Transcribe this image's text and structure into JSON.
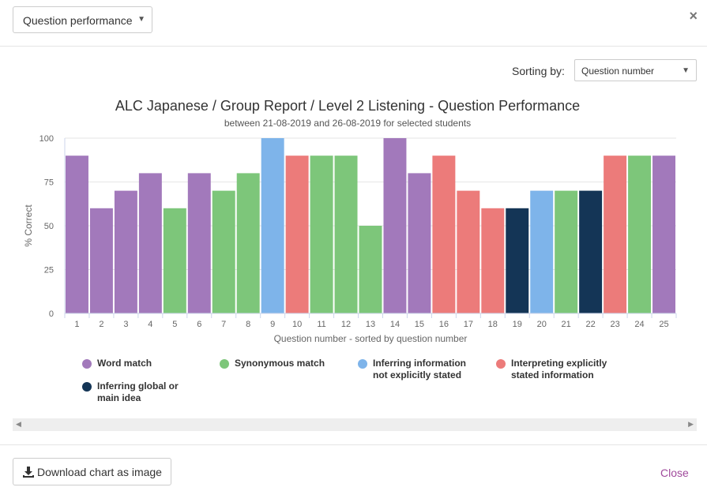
{
  "header": {
    "view_select": "Question performance",
    "close_icon": "×"
  },
  "sorting": {
    "label": "Sorting by:",
    "value": "Question number"
  },
  "footer": {
    "download_label": "Download chart as image",
    "close_label": "Close"
  },
  "chart_data": {
    "type": "bar",
    "title": "ALC Japanese / Group Report / Level 2 Listening - Question Performance",
    "subtitle": "between 21-08-2019 and 26-08-2019 for selected students",
    "xlabel": "Question number - sorted by question number",
    "ylabel": "% Correct",
    "ylim": [
      0,
      100
    ],
    "yticks": [
      "0",
      "25",
      "50",
      "75",
      "100"
    ],
    "grid": true,
    "categories": [
      "1",
      "2",
      "3",
      "4",
      "5",
      "6",
      "7",
      "8",
      "9",
      "10",
      "11",
      "12",
      "13",
      "14",
      "15",
      "16",
      "17",
      "18",
      "19",
      "20",
      "21",
      "22",
      "23",
      "24",
      "25"
    ],
    "values": [
      90,
      60,
      70,
      80,
      60,
      80,
      70,
      80,
      100,
      90,
      90,
      90,
      50,
      100,
      80,
      90,
      70,
      60,
      60,
      70,
      70,
      70,
      90,
      90,
      90
    ],
    "bar_types": [
      0,
      0,
      0,
      0,
      1,
      0,
      1,
      1,
      2,
      3,
      1,
      1,
      1,
      0,
      0,
      3,
      3,
      3,
      4,
      2,
      1,
      4,
      3,
      1,
      0
    ],
    "legend": [
      {
        "name": "Word match",
        "color": "#a279bb"
      },
      {
        "name": "Synonymous match",
        "color": "#7dc67a"
      },
      {
        "name": "Inferring information not explicitly stated",
        "color": "#7eb4ea"
      },
      {
        "name": "Interpreting explicitly stated information",
        "color": "#ec7b7a"
      },
      {
        "name": "Inferring global or main idea",
        "color": "#143556"
      }
    ],
    "legend_position": "bottom"
  }
}
